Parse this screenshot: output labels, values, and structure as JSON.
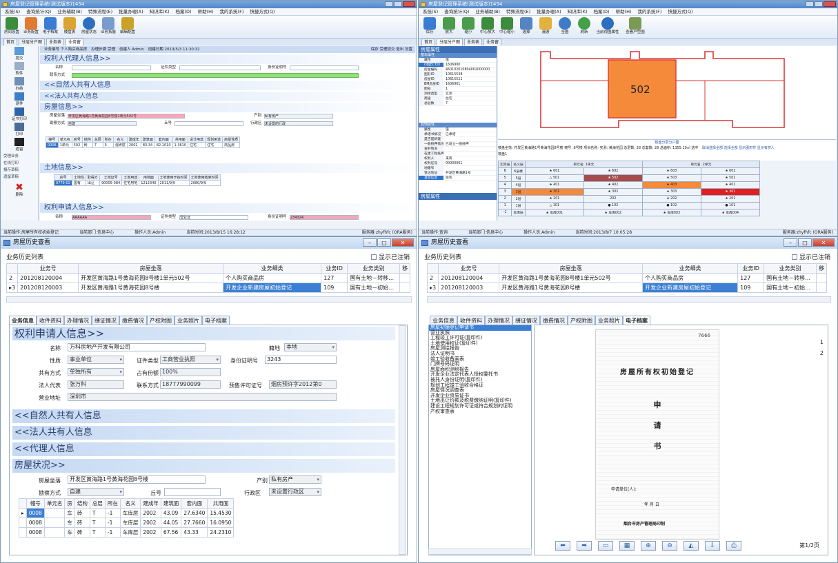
{
  "q1": {
    "title": "房屋登记管理系统(测试版本)1454",
    "menu": [
      "系统(S)",
      "查询统计(Q)",
      "业务辅助(B)",
      "特殊流程(E)",
      "批量办理(A)",
      "知识库(K)",
      "档案(D)",
      "帮助(H)",
      "我的系统(F)",
      "快捷方式(Q)"
    ],
    "tools": [
      "房间设置",
      "业务配置",
      "电子档案",
      "楼盘表",
      "房屋状态",
      "业务拓展",
      "编辑配置"
    ],
    "tabs": [
      "首页",
      "分层分户图",
      "业务表",
      "业务窗"
    ],
    "nav": [
      "提交",
      "附件",
      "办结",
      "退件",
      "证书打印",
      "打印",
      "遗留"
    ],
    "nav_sub": [
      "受理业务",
      "在线打印",
      "报存草稿",
      "遗留草稿",
      "删除"
    ],
    "bizbar": [
      "业务编号  个人购买商品房",
      "办理步骤 受理",
      "创建人 Admin",
      "创建日期 2013/5/3 11:30:32"
    ],
    "bizbar_actions": "保存  受理提交  退出  设置",
    "sec_agent": "权利人代理人信息>>",
    "agent_fields": {
      "name": "名称",
      "idtype": "证件类型",
      "idno": "身份证明号",
      "contact": "联系方式"
    },
    "sec_natural": "<<自然人共有人信息",
    "sec_legal": "<<法人共有人信息",
    "sec_house": "房屋信息>>",
    "house_fields": {
      "loc": "房屋坐落",
      "loc_value": "开发区黄海路1号黄海花园8号楼1单元502号",
      "kind": "产别",
      "kind_value": "私有房产",
      "way": "勘察方式",
      "way_value": "自建",
      "hill": "丘号",
      "district": "行政区",
      "district_value": "未设置的行政"
    },
    "house_table": {
      "headers": [
        "幢号",
        "单元名",
        "房号",
        "结构",
        "总层",
        "所在",
        "名义",
        "建成年",
        "建筑面",
        "套内面",
        "共用面",
        "设计用途",
        "规划用途",
        "房屋性质"
      ],
      "row": [
        "0008",
        "1单元",
        "502",
        "砖",
        "7",
        "5",
        "混砖层",
        "2002",
        "83.34",
        "82.1010",
        "1.3610",
        "住宅",
        "住宅",
        "商品房"
      ]
    },
    "sec_land": "土地信息>>",
    "land_table": {
      "headers": [
        "宗号",
        "土地性",
        "取得方",
        "土地证号",
        "土地用途",
        "用地面",
        "土地使用开始时间",
        "土地使用结束时间"
      ],
      "row": [
        "0779-02",
        "国有",
        "出让",
        "90005-084",
        "住宅用地",
        "1212340",
        "2011/9/9",
        "2080/9/9"
      ]
    },
    "sec_applicant": "权利申请人信息>>",
    "applicant_fields": {
      "name": "名称",
      "name_value": "AAAAAA",
      "idtype": "证件类型",
      "idtype_value": "营业证",
      "idno": "身份证明号",
      "idno_value": "234324"
    },
    "status_left": "当前操作:房屋所有权初始登记",
    "status_mid": "当前部门:信息中心",
    "status_user": "操作人员:Admin",
    "status_time": "当前时间:2013/8/15 16:28:12",
    "status_right": "服务器:zhyfhfc (ORA服务)"
  },
  "q2": {
    "title": "房屋登记管理系统(测试版本)1454",
    "menu": [
      "系统(S)",
      "查询统计(Q)",
      "业务辅助(B)",
      "特殊流程(E)",
      "批量办理(A)",
      "知识库(K)",
      "档案(D)",
      "帮助(H)",
      "我的系统(F)",
      "快捷方式(Q)"
    ],
    "tools": [
      "保存",
      "放大",
      "缩小",
      "中心放大",
      "中心缩小",
      "选择",
      "漫游",
      "全图",
      "刷新",
      "当前视图属性",
      "查看户型图"
    ],
    "tabs": [
      "首页",
      "分层分户图",
      "业务表",
      "业务窗"
    ],
    "props_title": "房屋属性",
    "props_basic": "基本属性",
    "props": [
      [
        "属性",
        "值"
      ],
      [
        "OBJECTID",
        "1606900"
      ],
      [
        "房屋编码",
        "460102010804002000000"
      ],
      [
        "图形ID",
        "10615538"
      ],
      [
        "房屋ID",
        "10615521"
      ],
      [
        "BM房屋ID",
        "1606901"
      ],
      [
        "图号",
        "1"
      ],
      [
        "测绘类型",
        "实测"
      ],
      [
        "用途",
        "住宅"
      ],
      [
        "总层数",
        "7"
      ]
    ],
    "props_other": "其他属性",
    "props2": [
      [
        "属性",
        "值"
      ],
      [
        "承诺书情况",
        "已承诺"
      ],
      [
        "是否是新建",
        ""
      ],
      [
        "一般抵押情况",
        "已设立一般抵押"
      ],
      [
        "查封情况",
        ""
      ],
      [
        "在建工程抵押",
        ""
      ],
      [
        "权利人",
        "来宾"
      ],
      [
        "权利证号",
        "00000001"
      ],
      [
        "地籍号",
        ""
      ],
      [
        "登记地址",
        "开发区黄海路1号"
      ],
      [
        "其他信息",
        "住宅"
      ]
    ],
    "props_footer": "房屋属性",
    "room_label": "502",
    "grid_caption": "楼盘分层分户图",
    "grid_info": "楼盘坐落: 开发区黄海路1号黄海花园8号楼  幢号: 8号楼  项目名称: 实测: 黄海花园  总层数: 28  总套数: 28  总面积: 1355.19㎡  选中: 1  在办: -1",
    "grid_links": "取消选择全部  选择全部  显示图形符  显示有权人",
    "grid_tab": "楼盘1",
    "grid_head": [
      "实际层",
      "名义层",
      "单元名: 1单元",
      "单元名: 2单元"
    ],
    "grid_rows": [
      [
        "6",
        "6层楼",
        "★ 601",
        "★ 602",
        "★ 603",
        "★ 601"
      ],
      [
        "5",
        "5层",
        "△ 501",
        "★ 502",
        "★ 503",
        "★ 501"
      ],
      [
        "4",
        "4层",
        "★ 401",
        "★ 402",
        "★ 403",
        "★ 401"
      ],
      [
        "3",
        "3层",
        "★ 301",
        "★ 302",
        "★ 303",
        "★ 301"
      ],
      [
        "2",
        "2层",
        "★ 201",
        "202",
        "★ 202",
        "★ 201"
      ],
      [
        "1",
        "1层",
        "△ 101",
        "● 102",
        "● 102",
        "● 101"
      ],
      [
        "-1",
        "车库层",
        "★ 车库001",
        "★ 车库002",
        "★ 车库003",
        "★ 车库004"
      ]
    ],
    "status_left": "当前操作:查询",
    "status_mid": "当前部门:信息中心",
    "status_user": "操作人员:Admin",
    "status_time": "当前时间:2013/8/7 10:05:28",
    "status_right": "服务器:zhyfhfc (ORA服务)"
  },
  "q3": {
    "title": "房屋历史查看",
    "hist_label": "业务历史列表",
    "show_cancel": "显示已注销",
    "table_headers": [
      "业务号",
      "房屋坐落",
      "业务细类",
      "业务ID",
      "业务类别",
      "移"
    ],
    "rows": [
      {
        "idx": "2",
        "no": "201208120004",
        "loc": "开发区黄海路1号黄海花园8号楼1单元502号",
        "type": "个人购买商品房",
        "id": "127",
        "cat": "国有土地－转移…"
      },
      {
        "idx": "3",
        "no": "201208120003",
        "loc": "开发区黄海路1号黄海花园8号楼",
        "type": "开发企业新建房屋初始登记",
        "id": "109",
        "cat": "国有土地－初始…"
      }
    ],
    "tabs": [
      "业务信息",
      "收件资料",
      "办理情况",
      "缮证情况",
      "缴费情况",
      "产权附图",
      "业务照片",
      "电子档案"
    ],
    "sec_applicant": "权利申请人信息>>",
    "applicant": {
      "name_l": "名称",
      "name_v": "万科房地产开发有限公司",
      "origin_l": "籍地",
      "origin_v": "本地",
      "nature_l": "性质",
      "nature_v": "事业单位",
      "idtype_l": "证件类型",
      "idtype_v": "工商营业执照",
      "idno_l": "身份证明号",
      "idno_v": "3243",
      "share_l": "共有方式",
      "share_v": "单独所有",
      "ratio_l": "占有份额",
      "ratio_v": "100%",
      "rep_l": "法人代表",
      "rep_v": "张万科",
      "phone_l": "联系方式",
      "phone_v": "18777990099",
      "presale_l": "预售许可证号",
      "presale_v": "烟房预许字2012第0",
      "addr_l": "营业地址",
      "addr_v": "深圳市"
    },
    "sec_natural": "<<自然人共有人信息",
    "sec_legal": "<<法人共有人信息",
    "sec_agent": "<<代理人信息",
    "sec_house": "房屋状况>>",
    "house": {
      "loc_l": "房屋坐落",
      "loc_v": "开发区黄海路1号黄海花园8号楼",
      "kind_l": "产别",
      "kind_v": "私有房产",
      "way_l": "勘察方式",
      "way_v": "自建",
      "hill_l": "丘号",
      "district_l": "行政区",
      "district_v": "未设置行政区"
    },
    "rtable_headers": [
      "幢号",
      "单元名",
      "房",
      "结构",
      "总层",
      "所在",
      "名义",
      "建成年",
      "建筑面",
      "套内面",
      "共用面"
    ],
    "rtable_rows": [
      [
        "0008",
        "",
        "车",
        "砖",
        "T",
        "-1",
        "车库层",
        "2002",
        "43.09",
        "27.6340",
        "15.4530"
      ],
      [
        "0008",
        "",
        "车",
        "砖",
        "T",
        "-1",
        "车库层",
        "2002",
        "44.05",
        "27.7660",
        "16.0950"
      ],
      [
        "0008",
        "",
        "车",
        "砖",
        "T",
        "-1",
        "车库层",
        "2002",
        "67.56",
        "43.33",
        "24.2310"
      ]
    ]
  },
  "q4": {
    "title": "房屋历史查看",
    "hist_label": "业务历史列表",
    "show_cancel": "显示已注销",
    "table_headers": [
      "业务号",
      "房屋坐落",
      "业务细类",
      "业务ID",
      "业务类别",
      "移"
    ],
    "rows": [
      {
        "idx": "2",
        "no": "201208120004",
        "loc": "开发区黄海路1号黄海花园8号楼1单元502号",
        "type": "个人购买商品房",
        "id": "127",
        "cat": "国有土地－转移…"
      },
      {
        "idx": "3",
        "no": "201208120003",
        "loc": "开发区黄海路1号黄海花园8号楼",
        "type": "开发企业新建房屋初始登记",
        "id": "109",
        "cat": "国有土地－初始…"
      }
    ],
    "tabs": [
      "业务信息",
      "收件资料",
      "办理情况",
      "缮证情况",
      "缴费情况",
      "产权附图",
      "业务照片",
      "电子档案"
    ],
    "tree": [
      "房屋初始登记申请书",
      "营业执照",
      "工程竣工许可证(复印件)",
      "土地使用权证(复印件)",
      "房屋测绘报告",
      "法人证明书",
      "竣工验收备案表",
      "门牌号码证明",
      "房屋面积测绘报告",
      "开发企业法定代表人授权委托书",
      "被托人身份证明(复印件)",
      "规划工程竣工验收合格证",
      "房屋情况调查表",
      "开发企业资质证书",
      "土地出让价款及税费缴纳证明(复印件)",
      "建设工程规划许可证或符合规划的证明",
      "产权审查表"
    ],
    "doc_title": "房屋所有权初始登记",
    "doc_chars": [
      "申",
      "请",
      "书"
    ],
    "doc_applicant": "申请单位(人):",
    "doc_date": "年  月  日",
    "doc_issuer": "烟台市房产管理局印制",
    "doc_note": "7666",
    "page_nums": [
      "1",
      "2"
    ],
    "page_info": "第1/2页"
  }
}
